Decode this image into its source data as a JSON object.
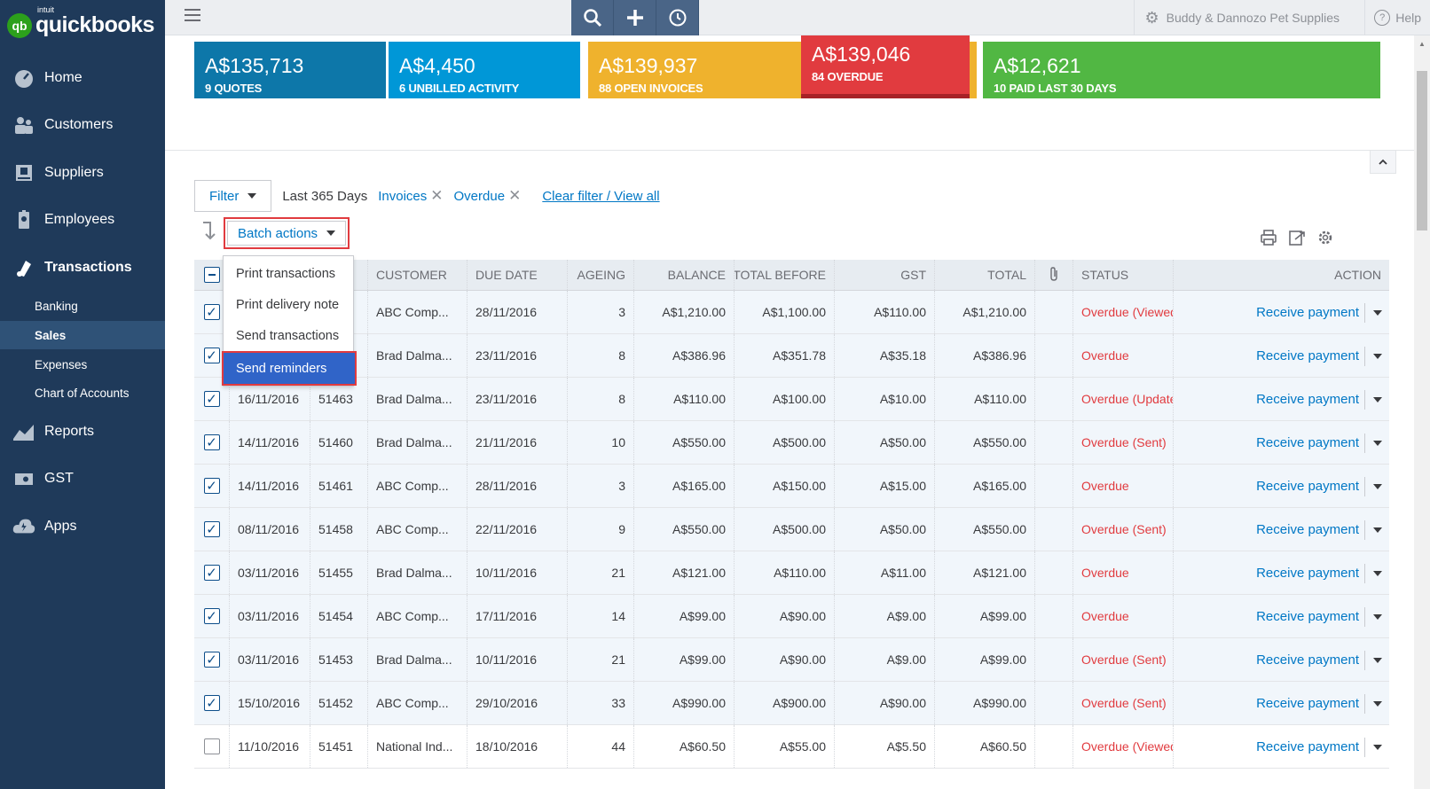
{
  "logo": {
    "brand_top": "intuit",
    "brand": "quickbooks",
    "badge": "qb"
  },
  "sidebar": {
    "items": [
      {
        "label": "Home",
        "icon": "dashboard-icon"
      },
      {
        "label": "Customers",
        "icon": "customers-icon"
      },
      {
        "label": "Suppliers",
        "icon": "suppliers-icon"
      },
      {
        "label": "Employees",
        "icon": "employees-icon"
      },
      {
        "label": "Transactions",
        "icon": "transactions-icon"
      }
    ],
    "sub_items": [
      {
        "label": "Banking"
      },
      {
        "label": "Sales"
      },
      {
        "label": "Expenses"
      },
      {
        "label": "Chart of Accounts"
      }
    ],
    "bottom_items": [
      {
        "label": "Reports",
        "icon": "reports-icon"
      },
      {
        "label": "GST",
        "icon": "gst-icon"
      },
      {
        "label": "Apps",
        "icon": "apps-icon"
      }
    ]
  },
  "topbar": {
    "company": "Buddy & Dannozo Pet Supplies",
    "help": "Help"
  },
  "money_bar": {
    "quotes": {
      "amount": "A$135,713",
      "label": "9 QUOTES"
    },
    "unbilled": {
      "amount": "A$4,450",
      "label": "6 UNBILLED ACTIVITY"
    },
    "open": {
      "amount": "A$139,937",
      "label": "88 OPEN INVOICES"
    },
    "overdue": {
      "amount": "A$139,046",
      "label": "84 OVERDUE"
    },
    "paid": {
      "amount": "A$12,621",
      "label": "10 PAID LAST 30 DAYS"
    }
  },
  "filters": {
    "filter_label": "Filter",
    "period": "Last 365 Days",
    "chips": [
      "Invoices",
      "Overdue"
    ],
    "clear": "Clear filter / View all"
  },
  "batch": {
    "label": "Batch actions",
    "menu": [
      "Print transactions",
      "Print delivery note",
      "Send transactions",
      "Send reminders"
    ]
  },
  "table": {
    "headers": [
      "",
      "",
      "",
      "CUSTOMER",
      "DUE DATE",
      "AGEING",
      "BALANCE",
      "TOTAL BEFORE",
      "GST",
      "TOTAL",
      "",
      "STATUS",
      "ACTION"
    ],
    "rows": [
      {
        "checked": true,
        "date": "",
        "no": "",
        "customer": "ABC Comp...",
        "due": "28/11/2016",
        "ageing": "3",
        "balance": "A$1,210.00",
        "before": "A$1,100.00",
        "gst": "A$110.00",
        "total": "A$1,210.00",
        "status": "Overdue (Viewed)",
        "action": "Receive payment"
      },
      {
        "checked": true,
        "date": "",
        "no": "",
        "customer": "Brad Dalma...",
        "due": "23/11/2016",
        "ageing": "8",
        "balance": "A$386.96",
        "before": "A$351.78",
        "gst": "A$35.18",
        "total": "A$386.96",
        "status": "Overdue",
        "action": "Receive payment"
      },
      {
        "checked": true,
        "date": "16/11/2016",
        "no": "51463",
        "customer": "Brad Dalma...",
        "due": "23/11/2016",
        "ageing": "8",
        "balance": "A$110.00",
        "before": "A$100.00",
        "gst": "A$10.00",
        "total": "A$110.00",
        "status": "Overdue (Updated)",
        "action": "Receive payment"
      },
      {
        "checked": true,
        "date": "14/11/2016",
        "no": "51460",
        "customer": "Brad Dalma...",
        "due": "21/11/2016",
        "ageing": "10",
        "balance": "A$550.00",
        "before": "A$500.00",
        "gst": "A$50.00",
        "total": "A$550.00",
        "status": "Overdue (Sent)",
        "action": "Receive payment"
      },
      {
        "checked": true,
        "date": "14/11/2016",
        "no": "51461",
        "customer": "ABC Comp...",
        "due": "28/11/2016",
        "ageing": "3",
        "balance": "A$165.00",
        "before": "A$150.00",
        "gst": "A$15.00",
        "total": "A$165.00",
        "status": "Overdue",
        "action": "Receive payment"
      },
      {
        "checked": true,
        "date": "08/11/2016",
        "no": "51458",
        "customer": "ABC Comp...",
        "due": "22/11/2016",
        "ageing": "9",
        "balance": "A$550.00",
        "before": "A$500.00",
        "gst": "A$50.00",
        "total": "A$550.00",
        "status": "Overdue (Sent)",
        "action": "Receive payment"
      },
      {
        "checked": true,
        "date": "03/11/2016",
        "no": "51455",
        "customer": "Brad Dalma...",
        "due": "10/11/2016",
        "ageing": "21",
        "balance": "A$121.00",
        "before": "A$110.00",
        "gst": "A$11.00",
        "total": "A$121.00",
        "status": "Overdue",
        "action": "Receive payment"
      },
      {
        "checked": true,
        "date": "03/11/2016",
        "no": "51454",
        "customer": "ABC Comp...",
        "due": "17/11/2016",
        "ageing": "14",
        "balance": "A$99.00",
        "before": "A$90.00",
        "gst": "A$9.00",
        "total": "A$99.00",
        "status": "Overdue",
        "action": "Receive payment"
      },
      {
        "checked": true,
        "date": "03/11/2016",
        "no": "51453",
        "customer": "Brad Dalma...",
        "due": "10/11/2016",
        "ageing": "21",
        "balance": "A$99.00",
        "before": "A$90.00",
        "gst": "A$9.00",
        "total": "A$99.00",
        "status": "Overdue (Sent)",
        "action": "Receive payment"
      },
      {
        "checked": true,
        "date": "15/10/2016",
        "no": "51452",
        "customer": "ABC Comp...",
        "due": "29/10/2016",
        "ageing": "33",
        "balance": "A$990.00",
        "before": "A$900.00",
        "gst": "A$90.00",
        "total": "A$990.00",
        "status": "Overdue (Sent)",
        "action": "Receive payment"
      },
      {
        "checked": false,
        "date": "11/10/2016",
        "no": "51451",
        "customer": "National Ind...",
        "due": "18/10/2016",
        "ageing": "44",
        "balance": "A$60.50",
        "before": "A$55.00",
        "gst": "A$5.50",
        "total": "A$60.50",
        "status": "Overdue (Viewed)",
        "action": "Receive payment"
      }
    ]
  },
  "colors": {
    "sidebar": "#1f3a5a",
    "quotes": "#0d77a9",
    "unbilled": "#0097d7",
    "open": "#efb22d",
    "overdue": "#e13b3f",
    "paid": "#51b743",
    "link": "#0077c5",
    "menu_selected": "#3064c8"
  }
}
